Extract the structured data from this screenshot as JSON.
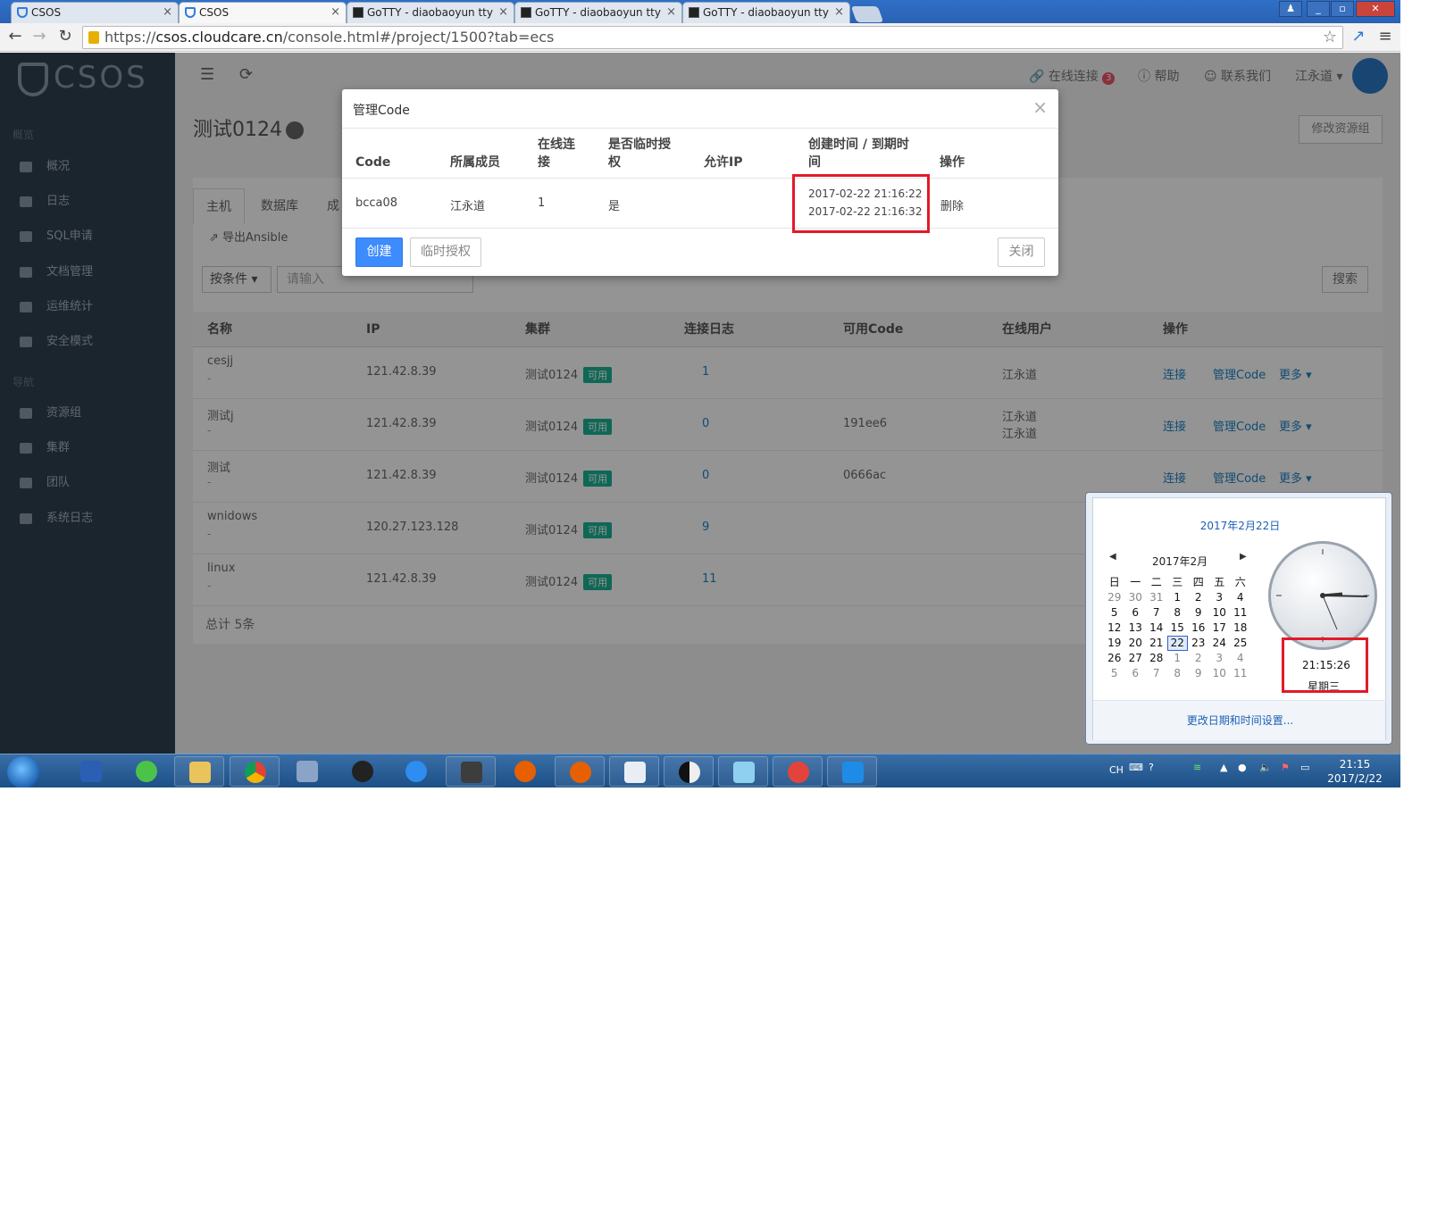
{
  "browser": {
    "tabs": [
      {
        "title": "CSOS",
        "icon": "csos-shield-icon"
      },
      {
        "title": "CSOS",
        "icon": "csos-shield-icon",
        "active": true
      },
      {
        "title": "GoTTY - diaobaoyun tty",
        "icon": "terminal-icon"
      },
      {
        "title": "GoTTY - diaobaoyun tty",
        "icon": "terminal-icon"
      },
      {
        "title": "GoTTY - diaobaoyun tty",
        "icon": "terminal-icon"
      }
    ],
    "url_scheme": "https://",
    "url_host": "csos.cloudcare.cn",
    "url_path": "/console.html#/project/1500?tab=ecs"
  },
  "sidebar": {
    "logo": "CSOS",
    "section1": "概览",
    "items1": [
      "概况",
      "日志",
      "SQL申请",
      "文档管理",
      "运维统计",
      "安全模式"
    ],
    "section2": "导航",
    "items2": [
      "资源组",
      "集群",
      "团队",
      "系统日志"
    ]
  },
  "topbar": {
    "online_label": "在线连接",
    "online_count": "3",
    "help": "帮助",
    "contact": "联系我们",
    "user": "江永道"
  },
  "page": {
    "title": "测试0124",
    "modify_button": "修改资源组",
    "tabs": [
      "主机",
      "数据库",
      "成"
    ],
    "export": "导出Ansible",
    "filter_select": "按条件",
    "filter_placeholder": "请输入",
    "search_button": "搜索",
    "columns": [
      "名称",
      "IP",
      "集群",
      "连接日志",
      "可用Code",
      "在线用户",
      "操作"
    ],
    "rows": [
      {
        "name": "cesjj",
        "sub": "-",
        "ip": "121.42.8.39",
        "cluster": "测试0124",
        "status": "可用",
        "log": "1",
        "code": "",
        "users": [
          "江永道"
        ]
      },
      {
        "name": "测试j",
        "sub": "-",
        "ip": "121.42.8.39",
        "cluster": "测试0124",
        "status": "可用",
        "log": "0",
        "code": "191ee6",
        "users": [
          "江永道",
          "江永道"
        ]
      },
      {
        "name": "测试",
        "sub": "-",
        "ip": "121.42.8.39",
        "cluster": "测试0124",
        "status": "可用",
        "log": "0",
        "code": "0666ac",
        "users": []
      },
      {
        "name": "wnidows",
        "sub": "-",
        "ip": "120.27.123.128",
        "cluster": "测试0124",
        "status": "可用",
        "log": "9",
        "code": "",
        "users": []
      },
      {
        "name": "linux",
        "sub": "-",
        "ip": "121.42.8.39",
        "cluster": "测试0124",
        "status": "可用",
        "log": "11",
        "code": "",
        "users": []
      }
    ],
    "actions": [
      "连接",
      "管理Code",
      "更多"
    ],
    "total": "总计 5条"
  },
  "modal": {
    "title": "管理Code",
    "headers": [
      "Code",
      "所属成员",
      "在线连接",
      "是否临时授权",
      "允许IP",
      "创建时间 / 到期时间",
      "操作"
    ],
    "row": {
      "code": "bcca08",
      "member": "江永道",
      "online": "1",
      "temp": "是",
      "ip": "",
      "created": "2017-02-22 21:16:22",
      "expires": "2017-02-22 21:16:32",
      "action": "删除"
    },
    "create_button": "创建",
    "temp_button": "临时授权",
    "close_button": "关闭"
  },
  "clock_popup": {
    "date_title": "2017年2月22日",
    "month": "2017年2月",
    "weekdays": [
      "日",
      "一",
      "二",
      "三",
      "四",
      "五",
      "六"
    ],
    "weeks": [
      [
        "29",
        "30",
        "31",
        "1",
        "2",
        "3",
        "4"
      ],
      [
        "5",
        "6",
        "7",
        "8",
        "9",
        "10",
        "11"
      ],
      [
        "12",
        "13",
        "14",
        "15",
        "16",
        "17",
        "18"
      ],
      [
        "19",
        "20",
        "21",
        "22",
        "23",
        "24",
        "25"
      ],
      [
        "26",
        "27",
        "28",
        "1",
        "2",
        "3",
        "4"
      ],
      [
        "5",
        "6",
        "7",
        "8",
        "9",
        "10",
        "11"
      ]
    ],
    "today": "22",
    "time": "21:15:26",
    "weekday": "星期三",
    "change_link": "更改日期和时间设置..."
  },
  "taskbar": {
    "lang": "CH",
    "clock_time": "21:15",
    "clock_date": "2017/2/22"
  }
}
